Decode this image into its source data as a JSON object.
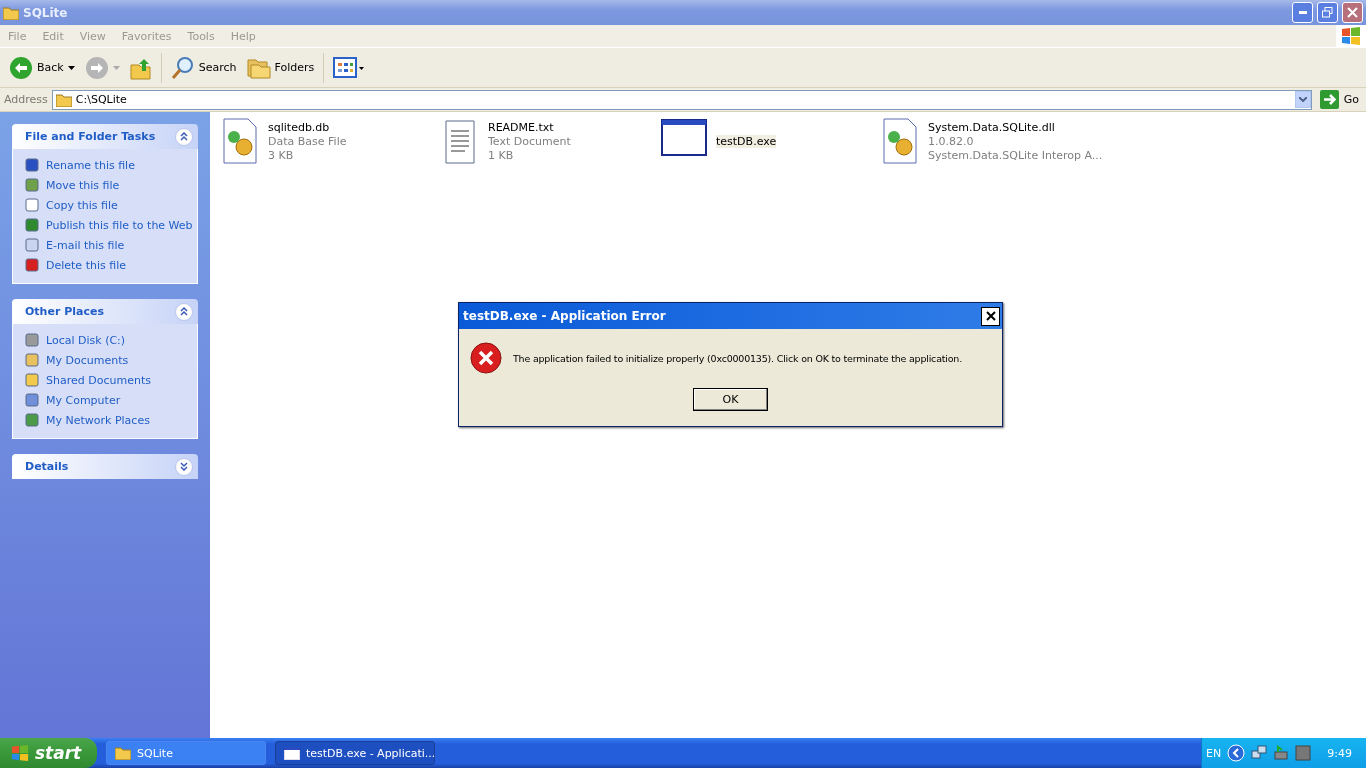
{
  "window": {
    "title": "SQLite"
  },
  "menu": [
    "File",
    "Edit",
    "View",
    "Favorites",
    "Tools",
    "Help"
  ],
  "toolbar": [
    {
      "kind": "back",
      "label": "Back"
    },
    {
      "kind": "forward"
    },
    {
      "kind": "up"
    },
    {
      "kind": "search",
      "label": "Search"
    },
    {
      "kind": "folders",
      "label": "Folders"
    },
    {
      "kind": "views"
    }
  ],
  "address": {
    "label": "Address",
    "value": "C:\\SQLite",
    "go": "Go"
  },
  "sidebar": [
    {
      "title": "File and Folder Tasks",
      "expanded": true,
      "items": [
        "Rename this file",
        "Move this file",
        "Copy this file",
        "Publish this file to the Web",
        "E-mail this file",
        "Delete this file"
      ]
    },
    {
      "title": "Other Places",
      "expanded": true,
      "items": [
        "Local Disk (C:)",
        "My Documents",
        "Shared Documents",
        "My Computer",
        "My Network Places"
      ]
    },
    {
      "title": "Details",
      "expanded": false
    }
  ],
  "files": [
    {
      "kind": "dll",
      "name": "sqlitedb.db",
      "lines": [
        "Data Base File",
        "3 KB"
      ],
      "selected": false
    },
    {
      "kind": "text",
      "name": "README.txt",
      "lines": [
        "Text Document",
        "1 KB"
      ],
      "selected": false
    },
    {
      "kind": "exe",
      "name": "testDB.exe",
      "selected": true
    },
    {
      "kind": "dll",
      "name": "System.Data.SQLite.dll",
      "lines": [
        "1.0.82.0",
        "System.Data.SQLite Interop A..."
      ],
      "selected": false
    }
  ],
  "dialog": {
    "title": "testDB.exe - Application Error",
    "message": "The application failed to initialize properly (0xc0000135). Click on OK to terminate the application.",
    "button": "OK"
  },
  "taskbar": {
    "start": "start",
    "tasks": [
      {
        "kind": "folder",
        "label": "SQLite",
        "selected": false
      },
      {
        "kind": "app",
        "label": "testDB.exe - Applicati...",
        "selected": true
      }
    ],
    "language": "EN",
    "time": "9:49"
  }
}
